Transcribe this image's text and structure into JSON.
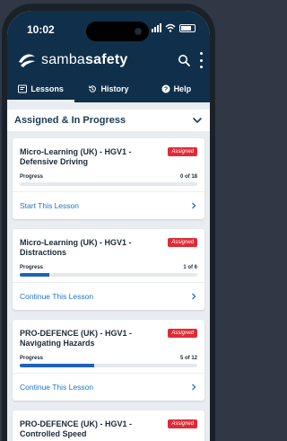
{
  "status": {
    "time": "10:02"
  },
  "brand": {
    "name_light": "samba",
    "name_bold": "safety"
  },
  "tabs": [
    {
      "label": "Lessons",
      "icon": "book-icon",
      "active": true
    },
    {
      "label": "History",
      "icon": "history-icon",
      "active": false
    },
    {
      "label": "Help",
      "icon": "help-icon",
      "active": false
    }
  ],
  "section": {
    "title": "Assigned & In Progress"
  },
  "cards": [
    {
      "title": "Micro-Learning (UK) - HGV1 - Defensive Driving",
      "badge": "Assigned",
      "progress_label": "Progress",
      "progress_text": "0 of 18",
      "progress": 0.0,
      "action": "Start This Lesson"
    },
    {
      "title": "Micro-Learning (UK) - HGV1 - Distractions",
      "badge": "Assigned",
      "progress_label": "Progress",
      "progress_text": "1 of 6",
      "progress": 0.1667,
      "action": "Continue This Lesson"
    },
    {
      "title": "PRO-DEFENCE (UK) - HGV1 - Navigating Hazards",
      "badge": "Assigned",
      "progress_label": "Progress",
      "progress_text": "5 of 12",
      "progress": 0.4167,
      "action": "Continue This Lesson"
    },
    {
      "title": "PRO-DEFENCE (UK) - HGV1 - Controlled Speed",
      "badge": "Assigned",
      "progress_label": "Progress",
      "progress_text": "",
      "progress": 0.0,
      "action": ""
    }
  ],
  "colors": {
    "header": "#102f4a",
    "accent": "#1d64b7",
    "badge": "#e02b35",
    "link": "#1e73c8"
  }
}
